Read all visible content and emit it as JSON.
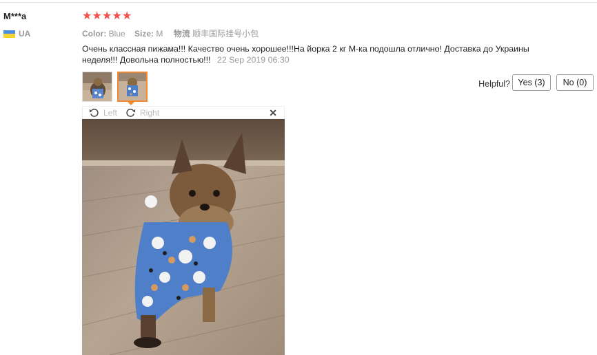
{
  "reviewer": {
    "name": "M***a",
    "country": "UA"
  },
  "rating": {
    "stars": 5
  },
  "attributes": {
    "color_label": "Color:",
    "color_value": "Blue",
    "size_label": "Size:",
    "size_value": "M",
    "shipping_label": "物流",
    "shipping_value": "顺丰国际挂号小包"
  },
  "review": {
    "text": "Очень классная пижама!!! Качество очень хорошее!!!На йорка 2 кг М-ка подошла отлично! Доставка до Украины неделя!!! Довольна полностью!!!",
    "date": "22 Sep 2019 06:30"
  },
  "helpful": {
    "label": "Helpful?",
    "yes": "Yes (3)",
    "no": "No (0)"
  },
  "viewer": {
    "left_label": "Left",
    "right_label": "Right",
    "close_symbol": "✕"
  },
  "icons": {
    "star": "star-icon",
    "rotate_left": "rotate-left-icon",
    "rotate_right": "rotate-right-icon",
    "close": "close-icon",
    "flag": "ukraine-flag-icon"
  },
  "colors": {
    "star": "#f2504b",
    "thumb_active_border": "#f08a32"
  }
}
